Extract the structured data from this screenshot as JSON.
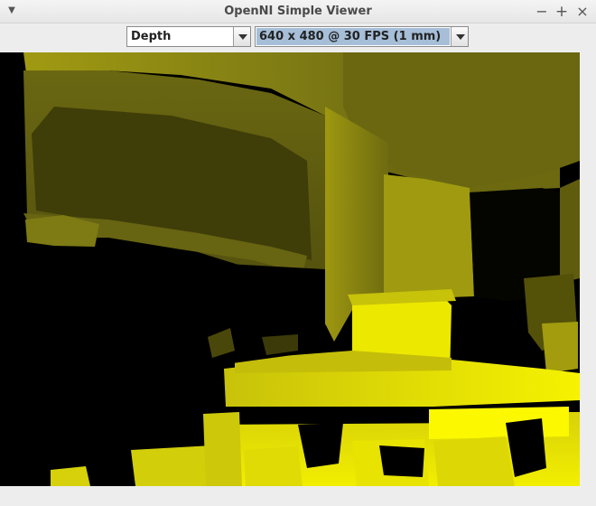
{
  "window": {
    "title": "OpenNI Simple Viewer",
    "controls": [
      "menu-icon",
      "minimize-icon",
      "maximize-icon",
      "close-icon"
    ]
  },
  "toolbar": {
    "stream_select": {
      "value": "Depth"
    },
    "mode_select": {
      "value": "640 x 480 @ 30 FPS (1 mm)"
    }
  },
  "view": {
    "content": "depth-image",
    "colors": {
      "near": "#f5f000",
      "mid": "#a8a000",
      "far": "#3c3a08",
      "none": "#000000"
    }
  }
}
